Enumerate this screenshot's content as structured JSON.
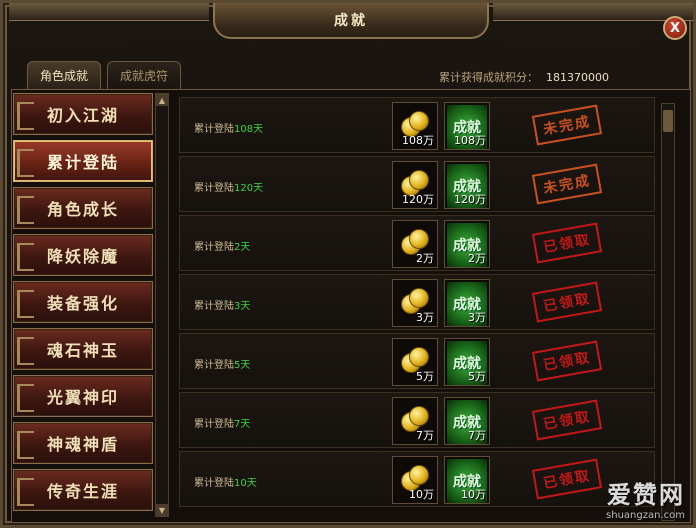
{
  "window": {
    "title": "成就",
    "close_label": "X"
  },
  "tabs": [
    {
      "label": "角色成就",
      "active": true
    },
    {
      "label": "成就虎符",
      "active": false
    }
  ],
  "total_points": {
    "label": "累计获得成就积分：",
    "value": "181370000"
  },
  "categories": [
    {
      "label": "初入江湖"
    },
    {
      "label": "累计登陆",
      "active": true
    },
    {
      "label": "角色成长"
    },
    {
      "label": "降妖除魔"
    },
    {
      "label": "装备强化"
    },
    {
      "label": "魂石神玉"
    },
    {
      "label": "光翼神印"
    },
    {
      "label": "神魂神盾"
    },
    {
      "label": "传奇生涯"
    }
  ],
  "achievements": [
    {
      "req_prefix": "累计登陆",
      "req_num": "108天",
      "coin": "108万",
      "points": "108万",
      "ach_text": "成就",
      "status": "未完成",
      "status_type": "pending"
    },
    {
      "req_prefix": "累计登陆",
      "req_num": "120天",
      "coin": "120万",
      "points": "120万",
      "ach_text": "成就",
      "status": "未完成",
      "status_type": "pending"
    },
    {
      "req_prefix": "累计登陆",
      "req_num": "2天",
      "coin": "2万",
      "points": "2万",
      "ach_text": "成就",
      "status": "已领取",
      "status_type": "claimed"
    },
    {
      "req_prefix": "累计登陆",
      "req_num": "3天",
      "coin": "3万",
      "points": "3万",
      "ach_text": "成就",
      "status": "已领取",
      "status_type": "claimed"
    },
    {
      "req_prefix": "累计登陆",
      "req_num": "5天",
      "coin": "5万",
      "points": "5万",
      "ach_text": "成就",
      "status": "已领取",
      "status_type": "claimed"
    },
    {
      "req_prefix": "累计登陆",
      "req_num": "7天",
      "coin": "7万",
      "points": "7万",
      "ach_text": "成就",
      "status": "已领取",
      "status_type": "claimed"
    },
    {
      "req_prefix": "累计登陆",
      "req_num": "10天",
      "coin": "10万",
      "points": "10万",
      "ach_text": "成就",
      "status": "已领取",
      "status_type": "claimed"
    }
  ],
  "scroll": {
    "up": "▲",
    "down": "▼"
  },
  "watermark": {
    "logo": "爱赞网",
    "url": "shuangzan.com"
  }
}
